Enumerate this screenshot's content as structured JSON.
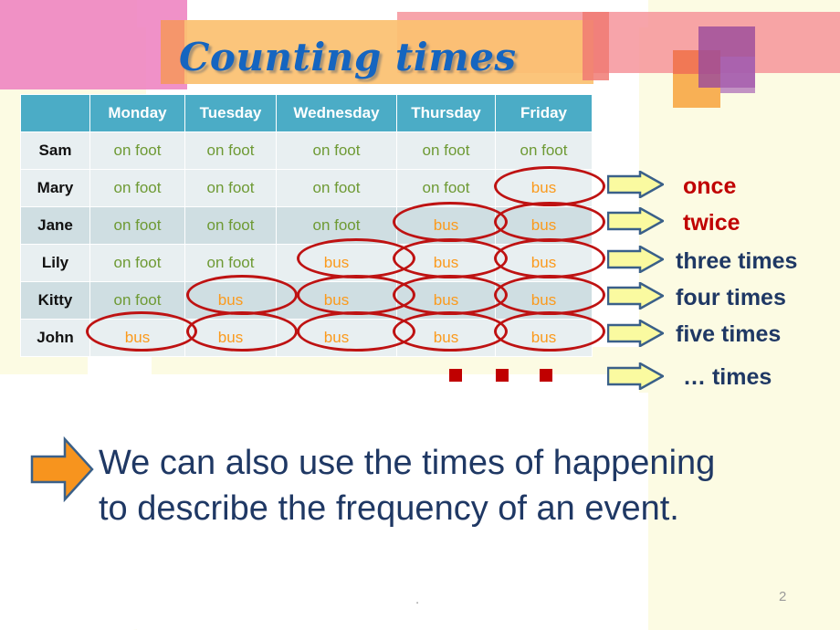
{
  "slide": {
    "title": "Counting times",
    "page_number": "2",
    "footer_dot": "."
  },
  "colors": {
    "title_blue": "#1565C0",
    "header_teal": "#4BACC6",
    "row_light": "#E8EFF1",
    "row_dark": "#CFDEE2",
    "on_foot_green": "#6E9A34",
    "bus_orange": "#FB9A1C",
    "ellipse_red": "#BE1212",
    "label_red": "#C00000",
    "label_navy": "#1F3864",
    "arrow_yellow": "#FAFAA0",
    "arrow_outline": "#3A6089",
    "bottom_arrow_orange": "#F7941E",
    "pink_block": "#EE82C0",
    "salmon_band": "#F59097",
    "tan_band": "#FBC171",
    "purple_block": "#9B4C9B",
    "cream_panel": "#FCFBE3"
  },
  "table": {
    "columns": [
      "",
      "Monday",
      "Tuesday",
      "Wednesday",
      "Thursday",
      "Friday"
    ],
    "rows": [
      {
        "name": "Sam",
        "values": [
          "on foot",
          "on foot",
          "on foot",
          "on foot",
          "on foot"
        ]
      },
      {
        "name": "Mary",
        "values": [
          "on foot",
          "on foot",
          "on foot",
          "on foot",
          "bus"
        ]
      },
      {
        "name": "Jane",
        "values": [
          "on foot",
          "on foot",
          "on foot",
          "bus",
          "bus"
        ]
      },
      {
        "name": "Lily",
        "values": [
          "on foot",
          "on foot",
          "bus",
          "bus",
          "bus"
        ]
      },
      {
        "name": "Kitty",
        "values": [
          "on foot",
          "bus",
          "bus",
          "bus",
          "bus"
        ]
      },
      {
        "name": "John",
        "values": [
          "bus",
          "bus",
          "bus",
          "bus",
          "bus"
        ]
      }
    ]
  },
  "frequency_labels": [
    {
      "text": "once",
      "style": "red"
    },
    {
      "text": "twice",
      "style": "red"
    },
    {
      "text": "three times",
      "style": "navy"
    },
    {
      "text": "four times",
      "style": "navy"
    },
    {
      "text": "five times",
      "style": "navy"
    },
    {
      "text": "… times",
      "style": "navy"
    }
  ],
  "bottom_statement": {
    "line1": "We can also use the times of happening",
    "line2": "to describe the frequency of an event."
  }
}
